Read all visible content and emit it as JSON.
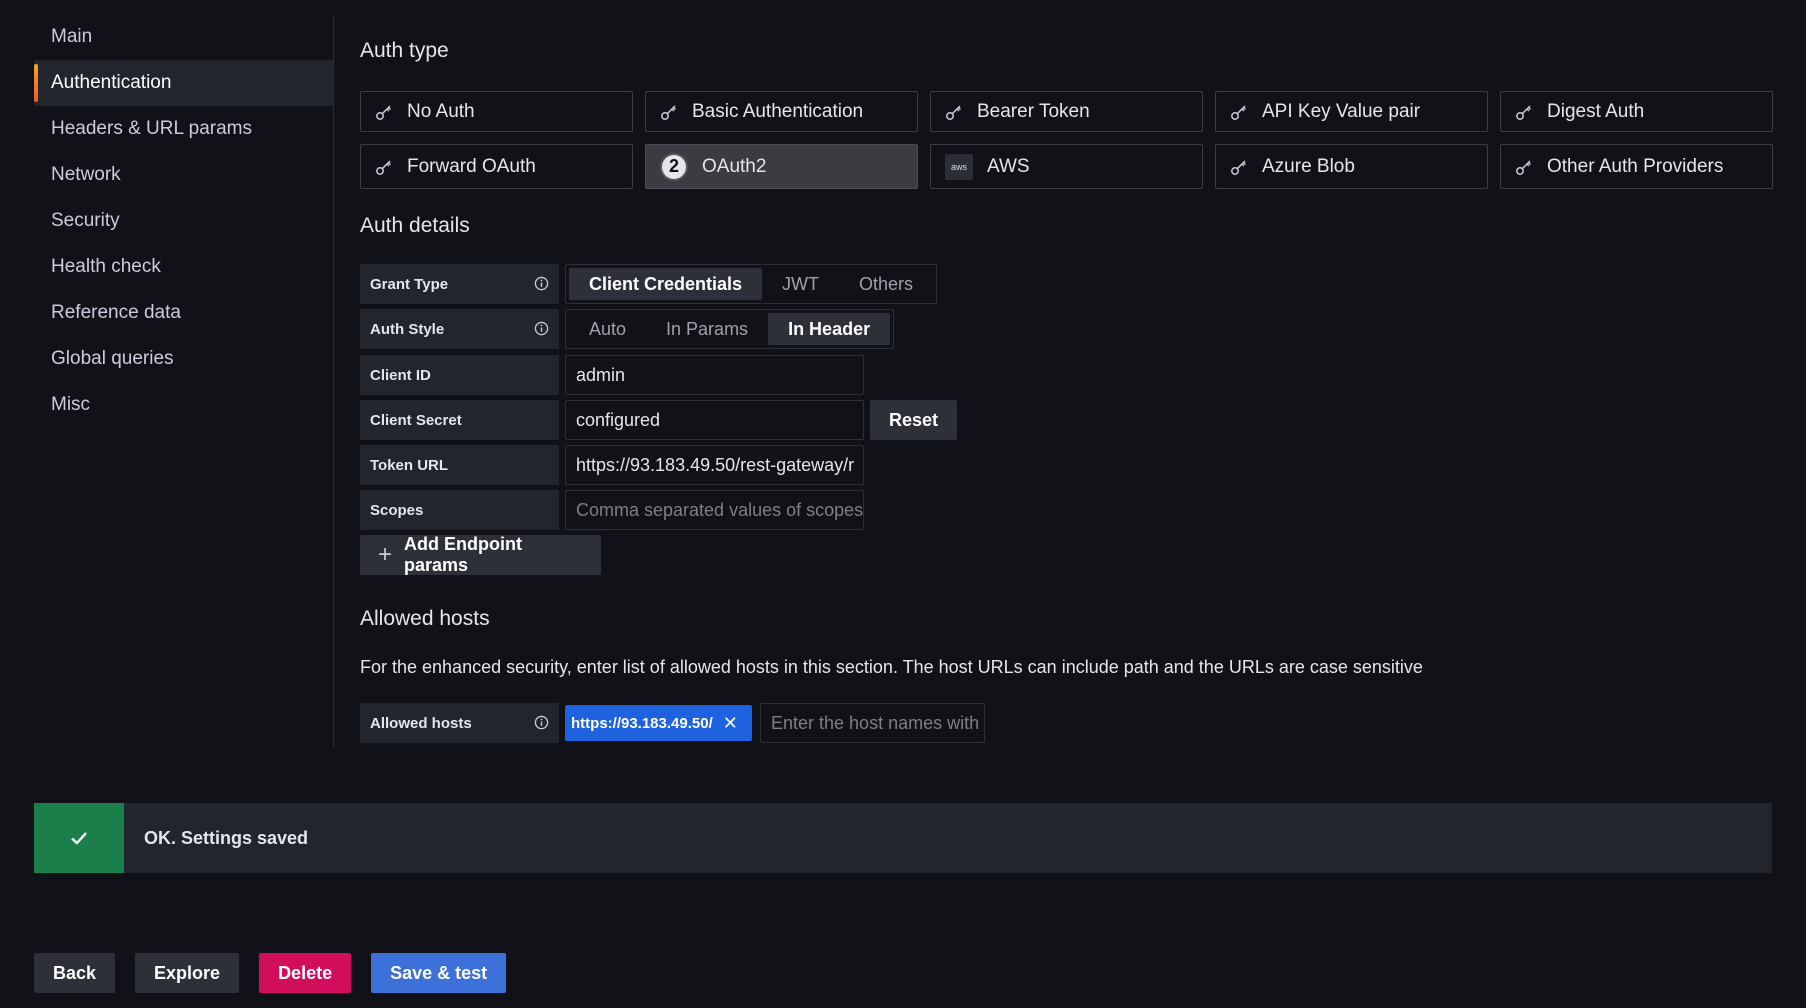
{
  "sidebar": {
    "items": [
      {
        "label": "Main"
      },
      {
        "label": "Authentication"
      },
      {
        "label": "Headers & URL params"
      },
      {
        "label": "Network"
      },
      {
        "label": "Security"
      },
      {
        "label": "Health check"
      },
      {
        "label": "Reference data"
      },
      {
        "label": "Global queries"
      },
      {
        "label": "Misc"
      }
    ],
    "active": "Authentication"
  },
  "auth_type": {
    "title": "Auth type",
    "options": [
      {
        "label": "No Auth",
        "icon": "key-icon"
      },
      {
        "label": "Basic Authentication",
        "icon": "key-icon"
      },
      {
        "label": "Bearer Token",
        "icon": "key-icon"
      },
      {
        "label": "API Key Value pair",
        "icon": "key-icon"
      },
      {
        "label": "Digest Auth",
        "icon": "key-icon"
      },
      {
        "label": "Forward OAuth",
        "icon": "key-icon"
      },
      {
        "label": "OAuth2",
        "icon": "oauth2-icon",
        "badge": "2"
      },
      {
        "label": "AWS",
        "icon": "aws-icon",
        "badge": "aws"
      },
      {
        "label": "Azure Blob",
        "icon": "key-icon"
      },
      {
        "label": "Other Auth Providers",
        "icon": "key-icon"
      }
    ],
    "selected": "OAuth2"
  },
  "auth_details": {
    "title": "Auth details",
    "grant_type": {
      "label": "Grant Type",
      "options": [
        "Client Credentials",
        "JWT",
        "Others"
      ],
      "selected": "Client Credentials"
    },
    "auth_style": {
      "label": "Auth Style",
      "options": [
        "Auto",
        "In Params",
        "In Header"
      ],
      "selected": "In Header"
    },
    "client_id": {
      "label": "Client ID",
      "value": "admin"
    },
    "client_secret": {
      "label": "Client Secret",
      "value": "configured",
      "reset_label": "Reset"
    },
    "token_url": {
      "label": "Token URL",
      "value": "https://93.183.49.50/rest-gateway/r"
    },
    "scopes": {
      "label": "Scopes",
      "placeholder": "Comma separated values of scopes"
    },
    "add_endpoint_label": "Add Endpoint params"
  },
  "allowed_hosts": {
    "title": "Allowed hosts",
    "description": "For the enhanced security, enter list of allowed hosts in this section. The host URLs can include path and the URLs are case sensitive",
    "label": "Allowed hosts",
    "chips": [
      "https://93.183.49.50/"
    ],
    "placeholder": "Enter the host names with"
  },
  "alert": {
    "text": "OK. Settings saved",
    "color": "#1a7f4b"
  },
  "footer": {
    "back": "Back",
    "explore": "Explore",
    "delete": "Delete",
    "save": "Save & test"
  },
  "colors": {
    "primary": "#3d71d9",
    "danger": "#d10e5c",
    "chip": "#1f62e0"
  }
}
